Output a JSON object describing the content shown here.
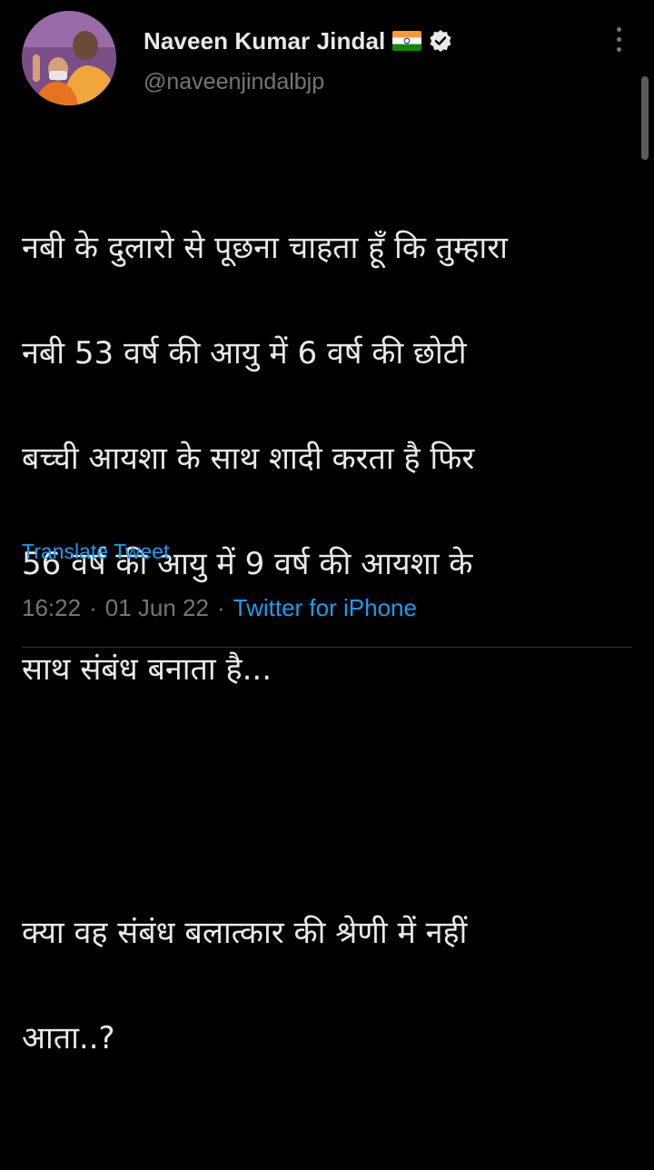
{
  "author": {
    "display_name": "Naveen Kumar Jindal",
    "handle": "@naveenjindalbjp",
    "flag_icon": "india-flag-icon",
    "verified_icon": "verified-badge-icon"
  },
  "tweet": {
    "paragraph_1_lines": [
      "नबी के दुलारो से पूछना चाहता हूँ कि तुम्हारा",
      "नबी 53 वर्ष की आयु में 6 वर्ष की छोटी",
      "बच्ची आयशा के साथ शादी करता है फिर",
      "56 वर्ष की आयु में 9 वर्ष की आयशा के",
      "साथ संबंध बनाता है..."
    ],
    "paragraph_2_lines": [
      "क्या वह संबंध बलात्कार की श्रेणी में नहीं",
      "आता..?"
    ],
    "translate_label": "Translate Tweet",
    "time": "16:22",
    "separator": "·",
    "date": "01 Jun 22",
    "source": "Twitter for iPhone"
  },
  "icons": {
    "more": "more-options-icon"
  },
  "colors": {
    "background": "#000000",
    "text": "#e7e9ea",
    "secondary": "#71767b",
    "link": "#1d9bf0"
  }
}
